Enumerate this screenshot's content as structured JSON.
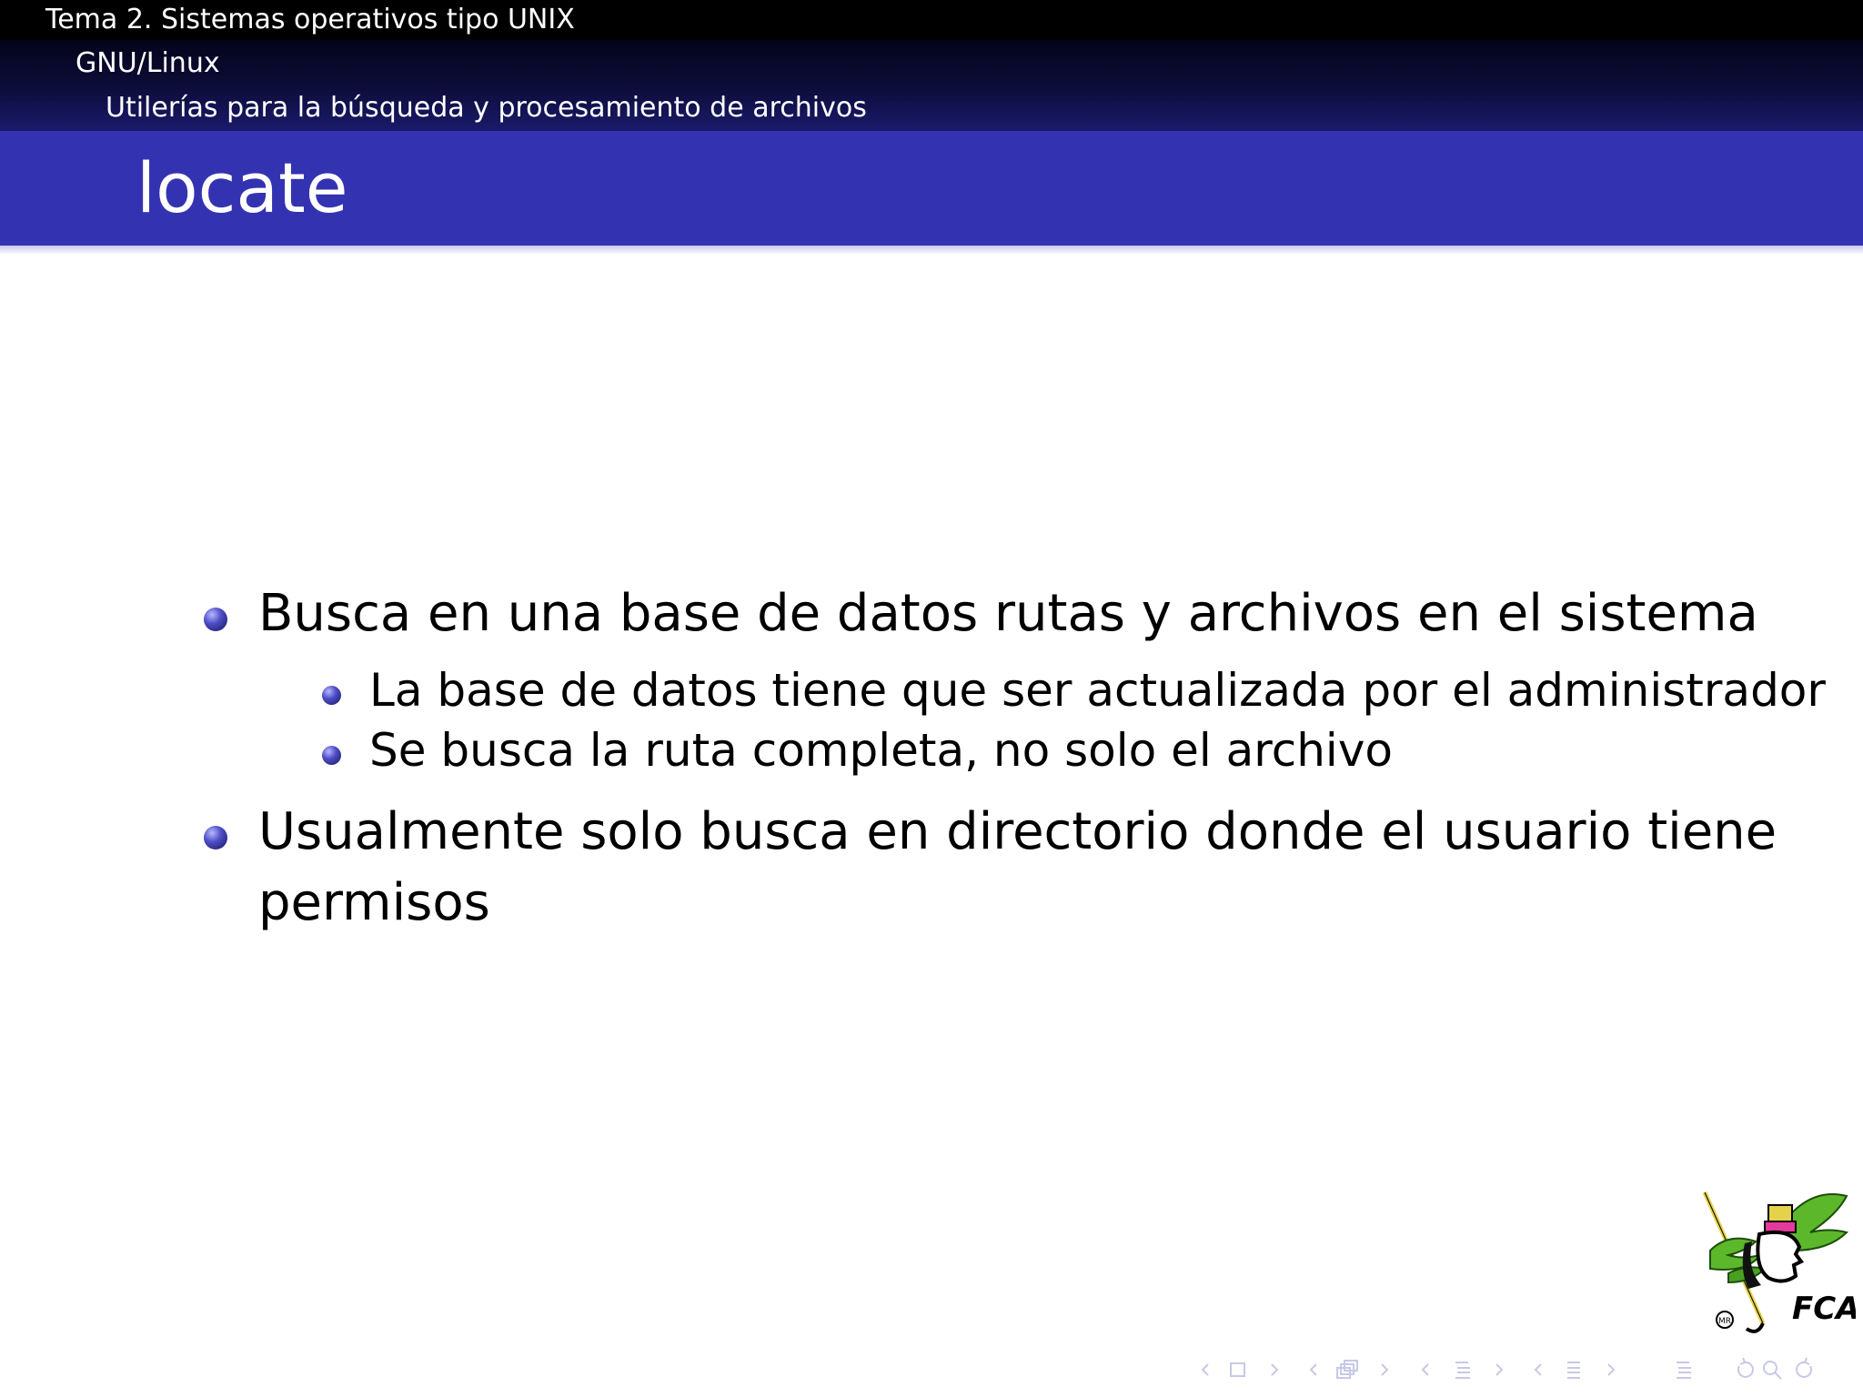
{
  "headline": {
    "section": "Tema 2. Sistemas operativos tipo UNIX",
    "subsection": "GNU/Linux",
    "subsubsection": "Utilerías para la búsqueda y procesamiento de archivos"
  },
  "frame": {
    "title": "locate"
  },
  "content": {
    "items": [
      {
        "text": "Busca en una base de datos rutas y archivos en el sistema",
        "subitems": [
          "La base de datos tiene que ser actualizada por el administrador",
          "Se busca la ruta completa, no solo el archivo"
        ]
      },
      {
        "line1": "Usualmente solo busca en directorio donde el usuario tiene",
        "line2": "permisos"
      }
    ]
  },
  "logo": {
    "text": "FCA",
    "mark": "MR"
  },
  "colors": {
    "title_bar": "#3333b2",
    "headline_top": "#000000",
    "bullet": "#4e4ec8",
    "nav_icons": "#c8c8e6"
  },
  "navigation": {
    "icons": [
      "nav-slide-prev-icon",
      "nav-slide-icon",
      "nav-slide-next-icon",
      "nav-frame-prev-icon",
      "nav-frame-icon",
      "nav-frame-next-icon",
      "nav-subsection-prev-icon",
      "nav-subsection-icon",
      "nav-subsection-next-icon",
      "nav-section-prev-icon",
      "nav-section-icon",
      "nav-section-next-icon",
      "nav-toc-icon",
      "nav-back-icon",
      "nav-search-icon",
      "nav-forward-icon"
    ]
  }
}
